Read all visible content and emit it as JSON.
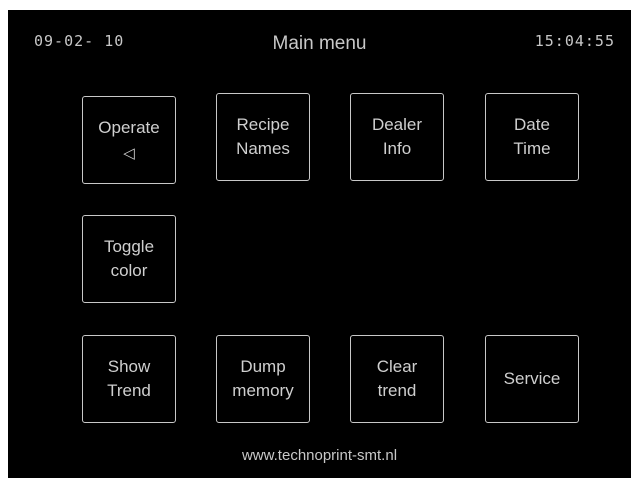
{
  "header": {
    "date": "09-02- 10",
    "title": "Main menu",
    "time": "15:04:55"
  },
  "buttons": {
    "operate": {
      "line1": "Operate",
      "icon": "speaker-icon"
    },
    "recipe": {
      "line1": "Recipe",
      "line2": "Names"
    },
    "dealer": {
      "line1": "Dealer",
      "line2": "Info"
    },
    "datetime": {
      "line1": "Date",
      "line2": "Time"
    },
    "toggle": {
      "line1": "Toggle",
      "line2": "color"
    },
    "trend": {
      "line1": "Show",
      "line2": "Trend"
    },
    "dump": {
      "line1": "Dump",
      "line2": "memory"
    },
    "clear": {
      "line1": "Clear",
      "line2": "trend"
    },
    "service": {
      "line1": "Service"
    }
  },
  "footer": {
    "url": "www.technoprint-smt.nl"
  },
  "colors": {
    "screen_bg": "#000000",
    "text": "#cfcfcf",
    "border": "#c8c8c8"
  }
}
